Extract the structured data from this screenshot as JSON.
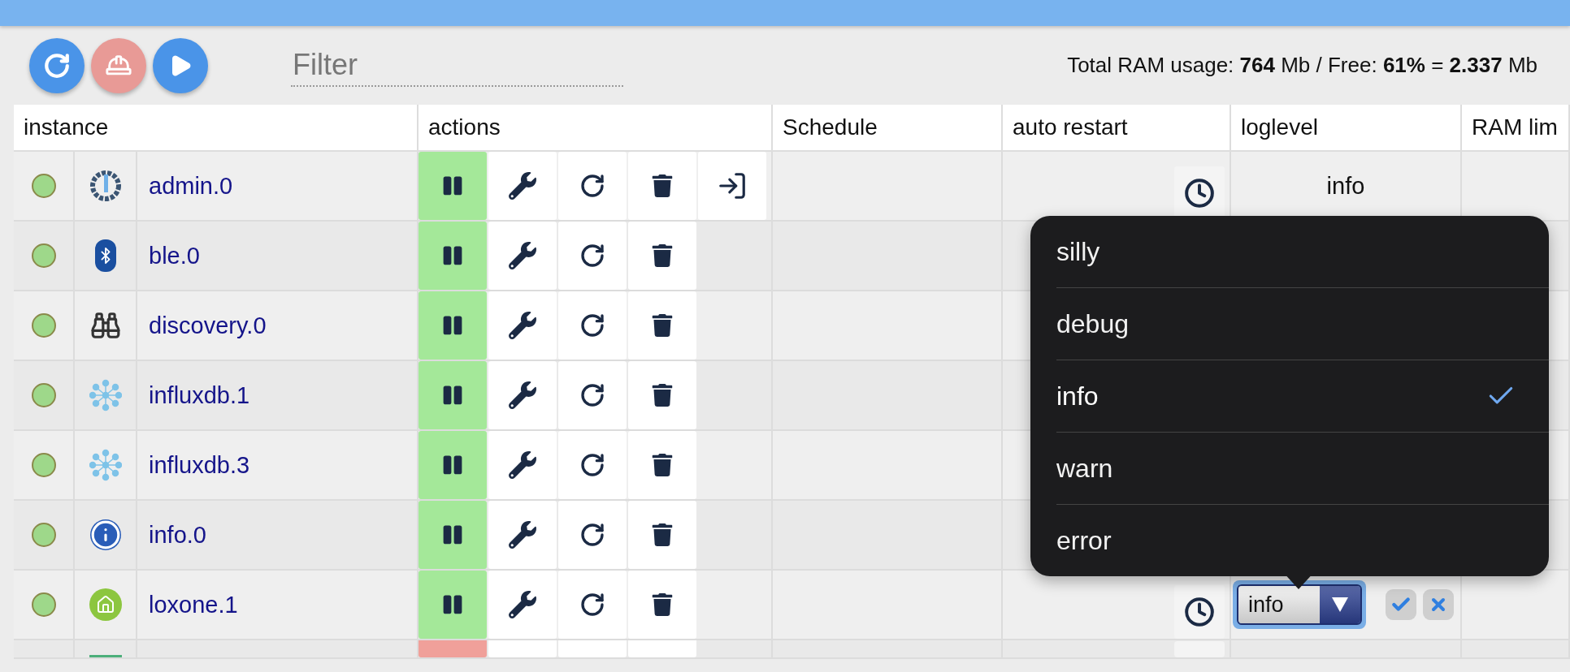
{
  "toolbar": {
    "filter": {
      "placeholder": "Filter"
    },
    "ram_info": "Total RAM usage: **764** Mb / Free: **61%** = **2.337** Mb"
  },
  "table": {
    "columns": [
      "instance",
      "actions",
      "Schedule",
      "auto restart",
      "loglevel",
      "RAM lim"
    ],
    "rows": [
      {
        "name": "admin.0",
        "color": "#9ed88a",
        "running": true,
        "login": true,
        "loglevel": "info"
      },
      {
        "name": "ble.0",
        "color": "#9ed88a",
        "running": true
      },
      {
        "name": "discovery.0",
        "color": "#9ed88a",
        "running": true
      },
      {
        "name": "influxdb.1",
        "color": "#9ed88a",
        "running": true
      },
      {
        "name": "influxdb.3",
        "color": "#9ed88a",
        "running": true
      },
      {
        "name": "info.0",
        "color": "#9ed88a",
        "running": true
      },
      {
        "name": "loxone.1",
        "color": "#9ed88a",
        "running": true,
        "loglevel_select": {
          "value": "info"
        }
      },
      {
        "running": false
      }
    ]
  },
  "loglevel_menu": {
    "options": [
      {
        "label": "silly",
        "selected": false
      },
      {
        "label": "debug",
        "selected": false
      },
      {
        "label": "info",
        "selected": true
      },
      {
        "label": "warn",
        "selected": false
      },
      {
        "label": "error",
        "selected": false
      }
    ]
  }
}
